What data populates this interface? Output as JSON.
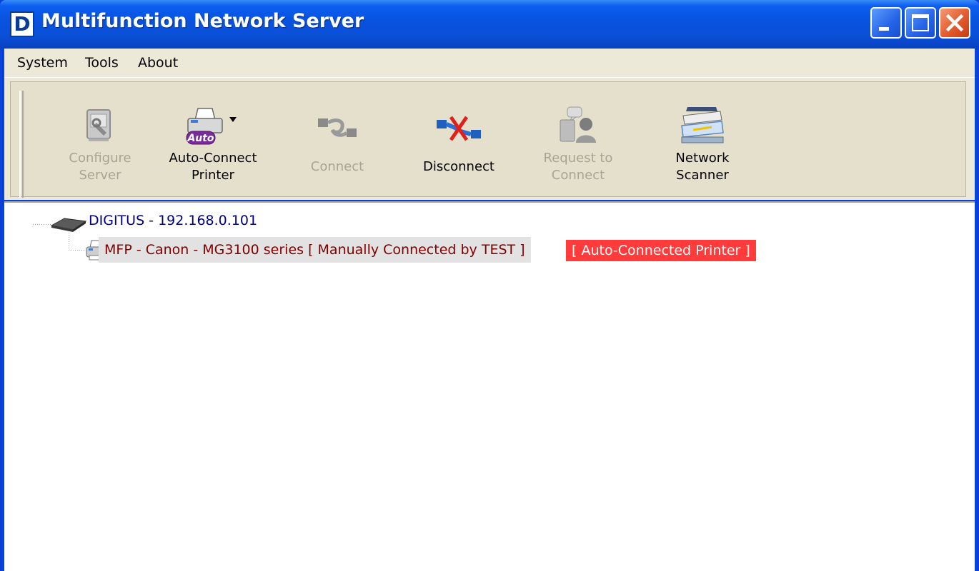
{
  "window": {
    "title": "Multifunction Network Server",
    "logo_letter": "D"
  },
  "menu": {
    "items": [
      "System",
      "Tools",
      "About"
    ]
  },
  "toolbar": {
    "buttons": [
      {
        "line1": "Configure",
        "line2": "Server",
        "enabled": false,
        "icon": "configure-server-icon"
      },
      {
        "line1": "Auto-Connect",
        "line2": "Printer",
        "enabled": true,
        "icon": "auto-connect-printer-icon",
        "icon_text": "Auto"
      },
      {
        "line1": "Connect",
        "line2": "",
        "enabled": false,
        "icon": "connect-icon"
      },
      {
        "line1": "Disconnect",
        "line2": "",
        "enabled": true,
        "icon": "disconnect-icon"
      },
      {
        "line1": "Request to",
        "line2": "Connect",
        "enabled": false,
        "icon": "request-connect-icon"
      },
      {
        "line1": "Network",
        "line2": "Scanner",
        "enabled": true,
        "icon": "network-scanner-icon"
      }
    ]
  },
  "tree": {
    "server": "DIGITUS - 192.168.0.101",
    "device": "MFP - Canon - MG3100 series [ Manually Connected by TEST ]",
    "badge": "[ Auto-Connected Printer ]"
  },
  "colors": {
    "server_text": "#000080",
    "device_text": "#800000",
    "badge_bg": "#ff3b3b",
    "badge_text": "#ffffff",
    "disabled_text": "#a7a591"
  }
}
